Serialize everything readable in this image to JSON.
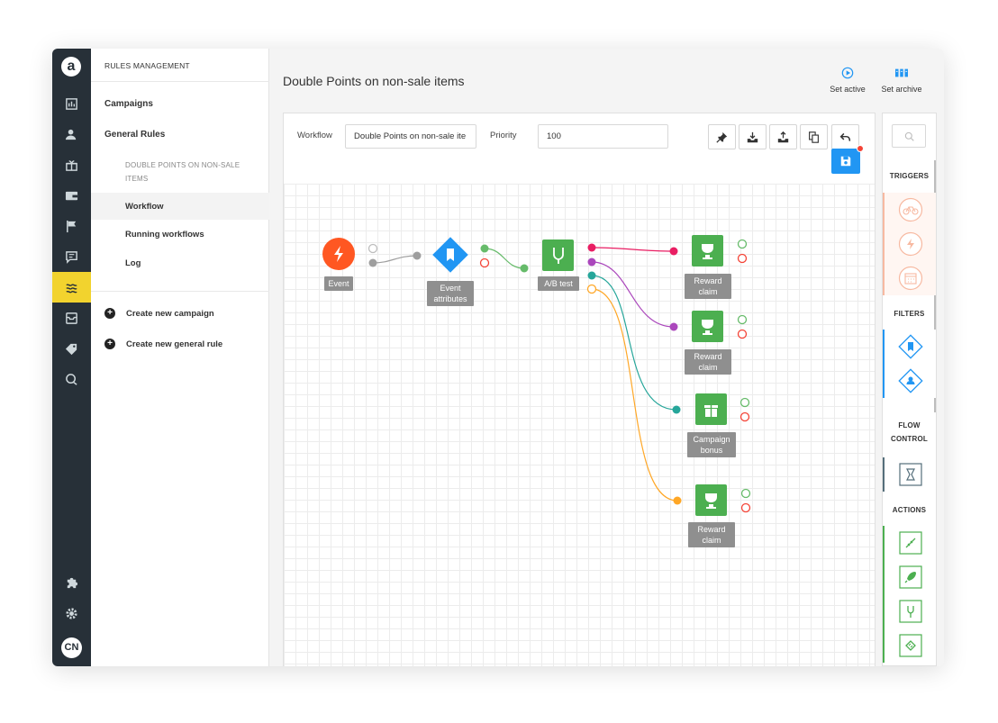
{
  "app": {
    "logo": "a",
    "user_initials": "CN",
    "rail_icons": [
      "dashboard-icon",
      "customers-icon",
      "gift-icon",
      "wallet-icon",
      "flag-icon",
      "message-icon",
      "rules-icon",
      "inbox-icon",
      "tags-icon",
      "chat-icon",
      "puzzle-icon",
      "settings-icon"
    ],
    "active_rail_icon": "rules-icon"
  },
  "nav": {
    "title": "RULES MANAGEMENT",
    "campaigns": "Campaigns",
    "general_rules": "General Rules",
    "rule_caption": "DOUBLE POINTS ON NON-SALE ITEMS",
    "workflow": "Workflow",
    "running_workflows": "Running workflows",
    "log": "Log",
    "create_campaign": "Create new campaign",
    "create_rule": "Create new general rule"
  },
  "main": {
    "title": "Double Points on non-sale items",
    "set_active": "Set active",
    "set_archive": "Set archive"
  },
  "editor": {
    "workflow_label": "Workflow",
    "workflow_value": "Double Points on non-sale ite",
    "priority_label": "Priority",
    "priority_value": "100",
    "toolbar_icons": [
      "pin-icon",
      "download-icon",
      "upload-icon",
      "copy-icon",
      "undo-icon"
    ],
    "save_icon": "save-icon"
  },
  "nodes": {
    "event": "Event",
    "event_attributes": "Event attributes",
    "ab_test": "A/B test",
    "reward_claim_1": "Reward claim",
    "reward_claim_2": "Reward claim",
    "campaign_bonus": "Campaign bonus",
    "reward_claim_3": "Reward claim"
  },
  "colors": {
    "event": "#ff5722",
    "attributes": "#2196f3",
    "action": "#4caf50",
    "wire_pink": "#e91e63",
    "wire_purple": "#ab47bc",
    "wire_teal": "#26a69a",
    "wire_orange": "#ffa726",
    "rail": "#273038",
    "rail_active": "#f2d32e"
  },
  "palette": {
    "triggers": "TRIGGERS",
    "filters": "FILTERS",
    "flow_control": "FLOW CONTROL",
    "actions": "ACTIONS"
  }
}
